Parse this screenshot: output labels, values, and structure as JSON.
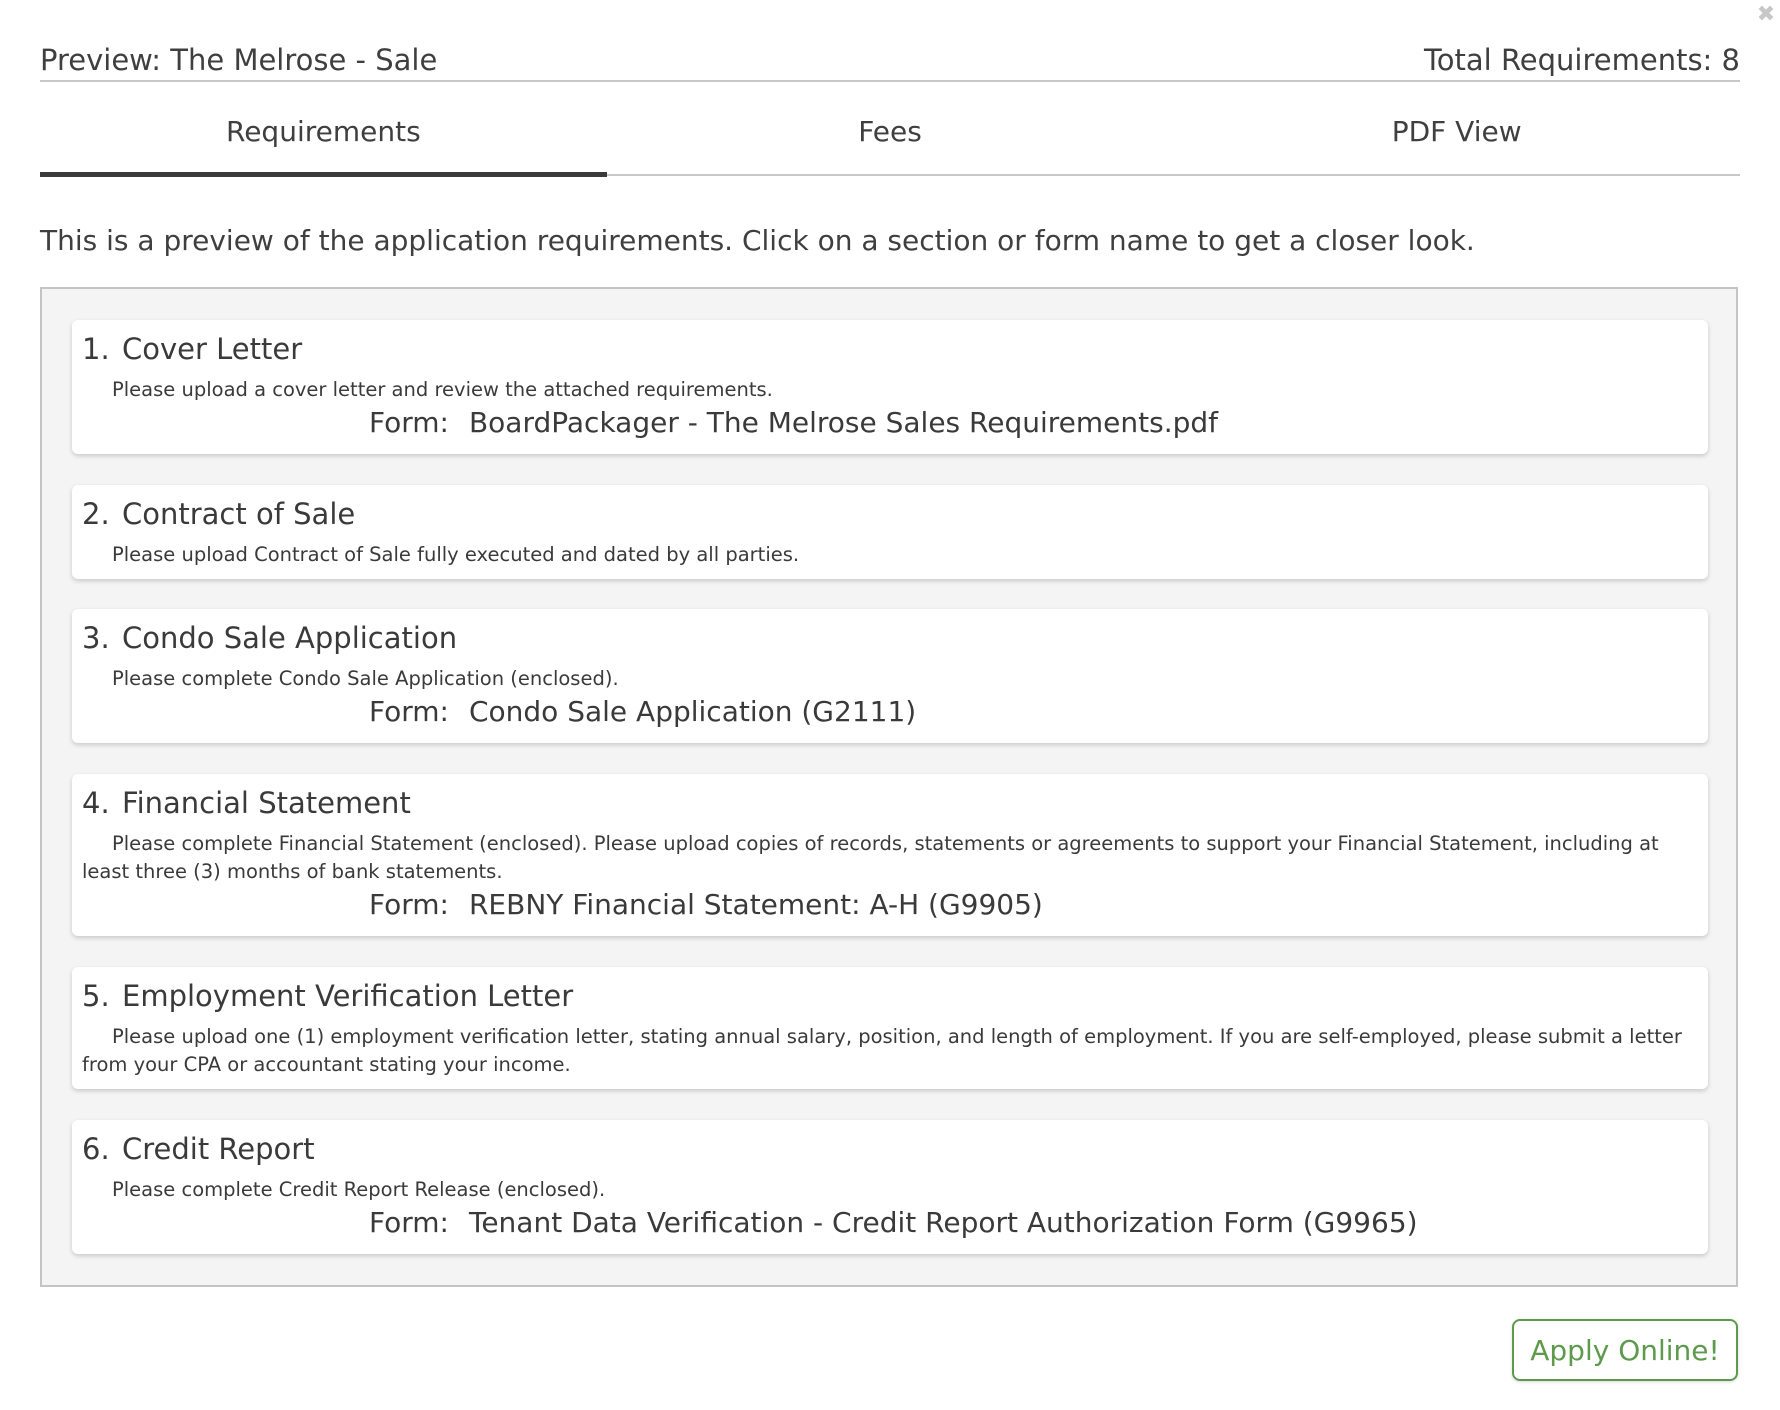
{
  "modal": {
    "close_glyph": "✖",
    "title": "Preview: The Melrose - Sale",
    "total_label": "Total Requirements: 8"
  },
  "tabs": [
    {
      "label": "Requirements",
      "active": true
    },
    {
      "label": "Fees",
      "active": false
    },
    {
      "label": "PDF View",
      "active": false
    }
  ],
  "intro": "This is a preview of the application requirements. Click on a section or form name to get a closer look.",
  "requirements": [
    {
      "num": "1.",
      "title": "Cover Letter",
      "desc": "Please upload a cover letter and review the attached requirements.",
      "form_label": "Form:",
      "form_name": "BoardPackager - The Melrose Sales Requirements.pdf"
    },
    {
      "num": "2.",
      "title": "Contract of Sale",
      "desc": "Please upload Contract of Sale fully executed and dated by all parties."
    },
    {
      "num": "3.",
      "title": "Condo Sale Application",
      "desc": "Please complete Condo Sale Application (enclosed).",
      "form_label": "Form:",
      "form_name": "Condo Sale Application (G2111)"
    },
    {
      "num": "4.",
      "title": "Financial Statement",
      "desc": "Please complete Financial Statement (enclosed). Please upload copies of records, statements or agreements to support your Financial Statement, including at least three (3) months of bank statements.",
      "form_label": "Form:",
      "form_name": "REBNY Financial Statement: A-H (G9905)"
    },
    {
      "num": "5.",
      "title": "Employment Verification Letter",
      "desc": "Please upload one (1) employment verification letter, stating annual salary, position, and length of employment. If you are self-employed, please submit a letter from your CPA or accountant stating your income."
    },
    {
      "num": "6.",
      "title": "Credit Report",
      "desc": "Please complete Credit Report Release (enclosed).",
      "form_label": "Form:",
      "form_name": "Tenant Data Verification - Credit Report Authorization Form (G9965)"
    }
  ],
  "apply_button": "Apply Online!",
  "colors": {
    "accent_green": "#5e9a4c",
    "panel_bg": "#f4f4f4"
  }
}
